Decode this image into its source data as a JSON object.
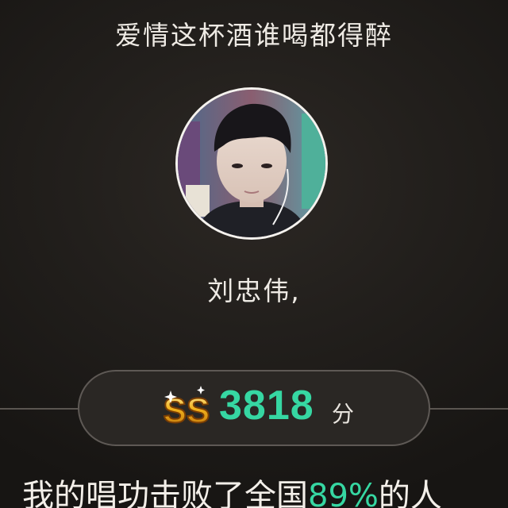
{
  "song": {
    "title": "爱情这杯酒谁喝都得醉"
  },
  "user": {
    "avatar_icon": "user-avatar-photo",
    "name": "刘忠伟,"
  },
  "score": {
    "grade_icon": "ss-grade-badge-icon",
    "grade_text": "SS",
    "value": "3818",
    "unit": "分"
  },
  "result": {
    "prefix": "我的唱功击败了全国",
    "percent": "89%",
    "suffix": "的人"
  },
  "colors": {
    "accent": "#36d7a2",
    "background": "#1b1917",
    "badge_gold": "#f2b21c"
  }
}
